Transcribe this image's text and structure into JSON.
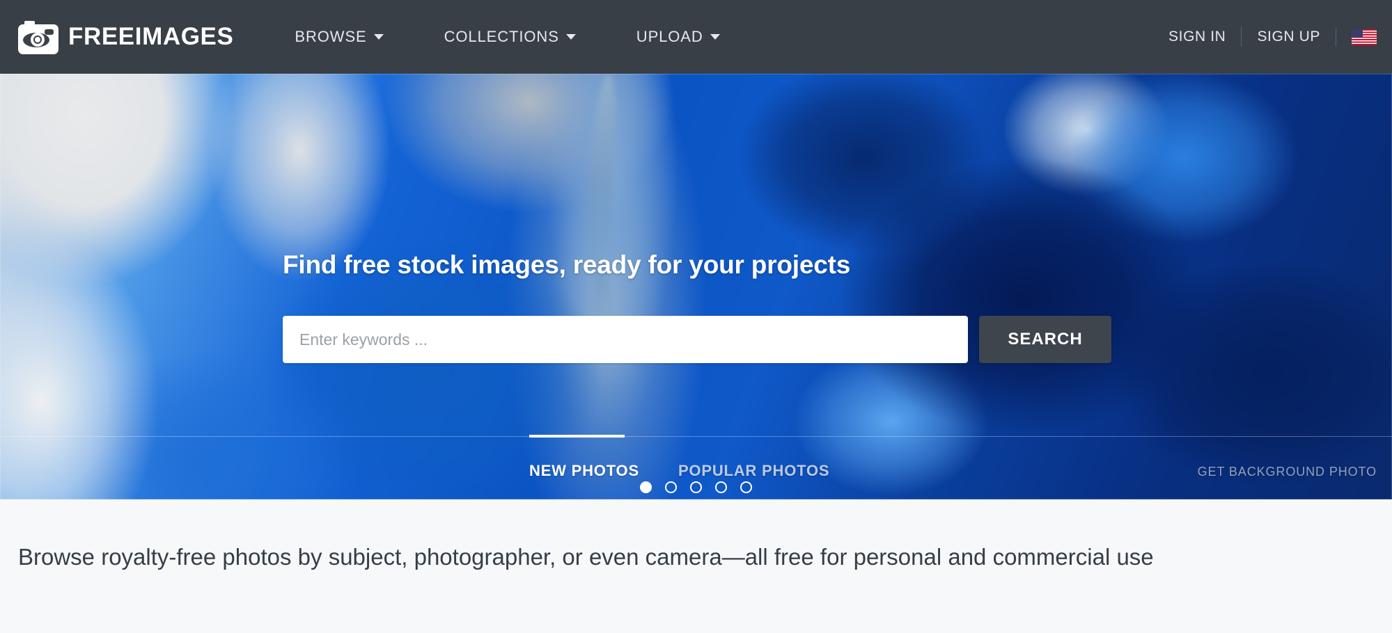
{
  "site": {
    "brand": "FREEIMAGES",
    "logo_icon": "camera-eye-icon"
  },
  "header": {
    "nav": [
      {
        "label": "BROWSE",
        "caret": "chevron-down-icon"
      },
      {
        "label": "COLLECTIONS",
        "caret": "chevron-down-icon"
      },
      {
        "label": "UPLOAD",
        "caret": "chevron-down-icon"
      }
    ],
    "sign_in": "SIGN IN",
    "sign_up": "SIGN UP",
    "language_flag": "us-flag-icon",
    "background_color": "#383f47",
    "text_color": "#e7e9eb"
  },
  "hero": {
    "title": "Find free stock images, ready for your projects",
    "search": {
      "placeholder": "Enter keywords ...",
      "value": "",
      "button_label": "SEARCH",
      "button_color": "#3e454d"
    },
    "carousel": {
      "total": 5,
      "active_index": 0
    },
    "background_photo_link": "GET BACKGROUND PHOTO",
    "tabs": [
      {
        "label": "NEW PHOTOS",
        "active": true
      },
      {
        "label": "POPULAR PHOTOS",
        "active": false
      }
    ]
  },
  "main": {
    "intro": "Browse royalty-free photos by subject, photographer, or even camera—all free for personal and commercial use",
    "background_color": "#f7f8f9",
    "text_color": "#353e48"
  }
}
